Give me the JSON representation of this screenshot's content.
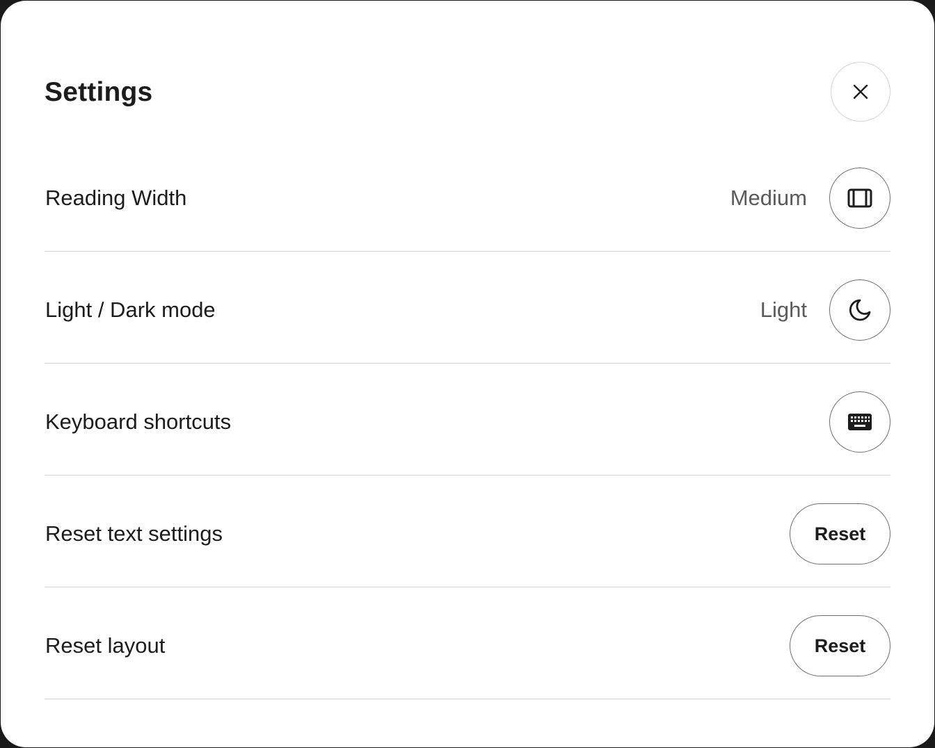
{
  "dialog": {
    "title": "Settings",
    "close_icon": "close-icon"
  },
  "rows": [
    {
      "label": "Reading Width",
      "value": "Medium",
      "icon": "reading-width-icon"
    },
    {
      "label": "Light / Dark mode",
      "value": "Light",
      "icon": "moon-icon"
    },
    {
      "label": "Keyboard shortcuts",
      "icon": "keyboard-icon"
    },
    {
      "label": "Reset text settings",
      "button_label": "Reset"
    },
    {
      "label": "Reset layout",
      "button_label": "Reset"
    }
  ],
  "colors": {
    "text": "#1c1c1c",
    "muted_text": "#5a5a5a",
    "divider": "#d2d2d2",
    "button_border": "#6e6e6e"
  }
}
